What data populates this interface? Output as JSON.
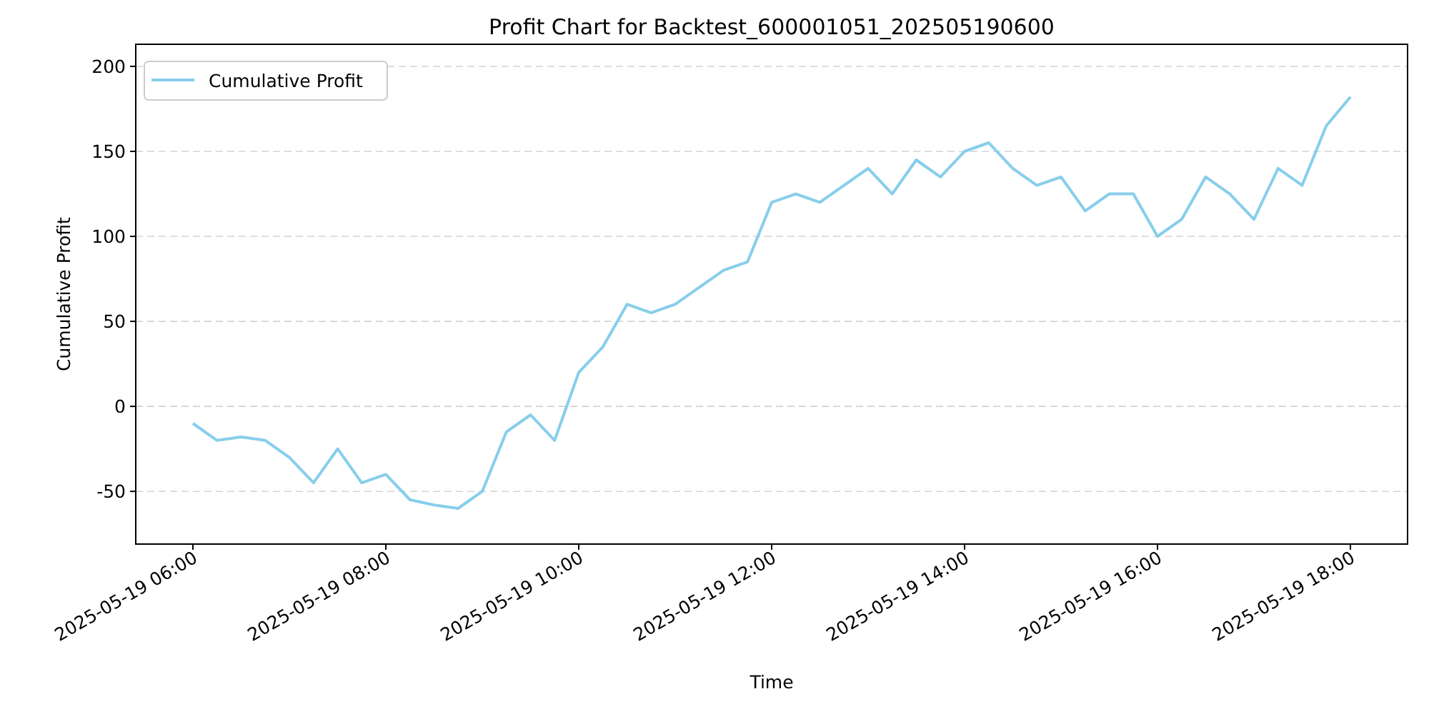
{
  "chart": {
    "chart_data": {
      "type": "line",
      "title": "Profit Chart for Backtest_600001051_202505190600",
      "xlabel": "Time",
      "ylabel": "Cumulative Profit",
      "categories": [
        "2025-05-19 06:00",
        null,
        null,
        null,
        null,
        null,
        null,
        null,
        "2025-05-19 08:00",
        null,
        null,
        null,
        null,
        null,
        null,
        null,
        "2025-05-19 10:00",
        null,
        null,
        null,
        null,
        null,
        null,
        null,
        "2025-05-19 12:00",
        null,
        null,
        null,
        null,
        null,
        null,
        null,
        "2025-05-19 14:00",
        null,
        null,
        null,
        null,
        null,
        null,
        null,
        "2025-05-19 16:00",
        null,
        null,
        null,
        null,
        null,
        null,
        null,
        "2025-05-19 18:00"
      ],
      "series": [
        {
          "name": "Cumulative Profit",
          "color": "#87ceeb",
          "values": [
            -10,
            -20,
            -18,
            -20,
            -30,
            -45,
            -25,
            -45,
            -40,
            -55,
            -58,
            -60,
            -50,
            -15,
            -5,
            -20,
            20,
            35,
            60,
            55,
            60,
            70,
            80,
            85,
            120,
            125,
            120,
            130,
            140,
            125,
            145,
            135,
            150,
            155,
            140,
            130,
            135,
            115,
            125,
            125,
            100,
            110,
            135,
            125,
            110,
            140,
            130,
            165,
            182
          ]
        }
      ],
      "ylim": [
        -81,
        213
      ],
      "grid": true,
      "yticks": [
        -50,
        0,
        50,
        100,
        150,
        200
      ]
    }
  }
}
